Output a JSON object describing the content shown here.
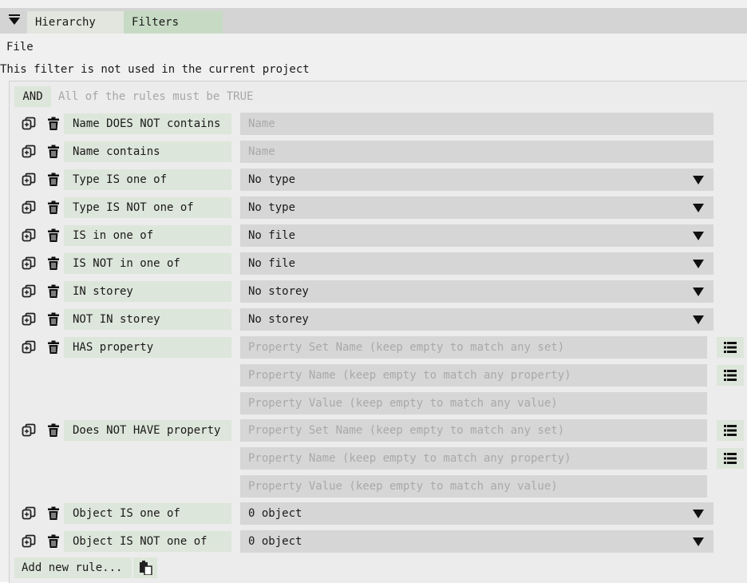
{
  "tabs": {
    "hierarchy": "Hierarchy",
    "filters": "Filters"
  },
  "menu": {
    "file": "File"
  },
  "notice": "This filter is not used in the current project",
  "logic": {
    "operator": "AND",
    "hint": "All of the rules must be TRUE"
  },
  "rules": [
    {
      "label": "Name DOES NOT contains",
      "placeholder": "Name"
    },
    {
      "label": "Name contains",
      "placeholder": "Name"
    },
    {
      "label": "Type IS one of",
      "value": "No type"
    },
    {
      "label": "Type IS NOT one of",
      "value": "No type"
    },
    {
      "label": "IS in one of",
      "value": "No file"
    },
    {
      "label": "IS NOT in one of",
      "value": "No file"
    },
    {
      "label": "IN storey",
      "value": "No storey"
    },
    {
      "label": "NOT IN storey",
      "value": "No storey"
    },
    {
      "label": "HAS property",
      "set_placeholder": "Property Set Name (keep empty to match any set)",
      "name_placeholder": "Property Name (keep empty to match any property)",
      "value_placeholder": "Property Value (keep empty to match any value)"
    },
    {
      "label": "Does NOT HAVE property",
      "set_placeholder": "Property Set Name (keep empty to match any set)",
      "name_placeholder": "Property Name (keep empty to match any property)",
      "value_placeholder": "Property Value (keep empty to match any value)"
    },
    {
      "label": "Object IS one of",
      "value": "0 object"
    },
    {
      "label": "Object IS NOT one of",
      "value": "0 object"
    }
  ],
  "add_rule": "Add new rule...",
  "icons": {
    "collapse": "triangle-down-icon",
    "duplicate": "copy-icon",
    "delete": "trash-icon",
    "list": "list-icon",
    "paste": "paste-icon"
  },
  "colors": {
    "tab_active": "#c7dbc4",
    "button_bg": "#dde6da",
    "field_bg": "#d6d6d6",
    "toolbar_bg": "#d4d4d4"
  }
}
